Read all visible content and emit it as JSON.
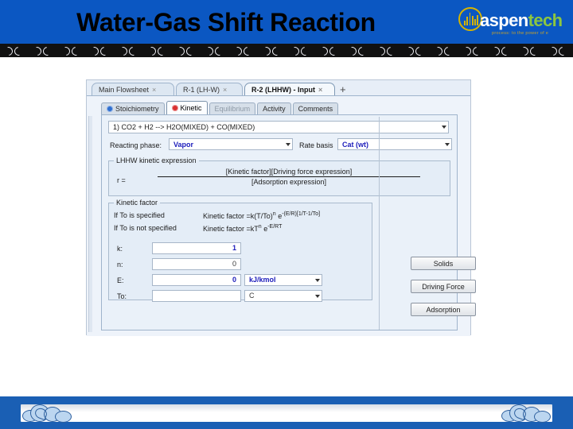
{
  "slide": {
    "title": "Water-Gas Shift Reaction",
    "logo": {
      "brand_a": "aspen",
      "brand_b": "tech",
      "tagline": "process: to the power of e",
      "mark_color": "#d6b400",
      "text_color": "#8dc63f"
    },
    "header_color": "#0b57c2",
    "footer_color": "#1a5fb4"
  },
  "window": {
    "tabs": [
      {
        "label": "Main Flowsheet",
        "close": "×",
        "active": false
      },
      {
        "label": "R-1 (LH-W)",
        "close": "×",
        "active": false
      },
      {
        "label": "R-2 (LHHW) - Input",
        "close": "×",
        "active": true
      }
    ],
    "new_tab": "+",
    "sub_tabs": [
      {
        "label": "Stoichiometry",
        "icon": "blue-circle-check-icon",
        "selected": false
      },
      {
        "label": "Kinetic",
        "icon": "red-half-circle-icon",
        "selected": true
      },
      {
        "label": "Equilibrium",
        "icon": "",
        "selected": false,
        "disabled": true
      },
      {
        "label": "Activity",
        "icon": "",
        "selected": false
      },
      {
        "label": "Comments",
        "icon": "",
        "selected": false
      }
    ],
    "reaction_select": {
      "value": "1) CO2 + H2  -->  H2O(MIXED) + CO(MIXED)"
    },
    "reacting_phase": {
      "label": "Reacting phase:",
      "value": "Vapor"
    },
    "rate_basis": {
      "label": "Rate basis",
      "value": "Cat (wt)"
    },
    "kinetic_expression": {
      "legend": "LHHW kinetic expression",
      "r_equals": "r =",
      "numerator": "[Kinetic factor][Driving force expression]",
      "denominator": "[Adsorption expression]"
    },
    "kinetic_factor": {
      "legend": "Kinetic factor",
      "line1_label": "If To is specified",
      "line1_formula_a": "Kinetic factor =k(T/To)",
      "line1_sup_n": "n",
      "line1_e": "e",
      "line1_sup_exp": "-(E/R)[1/T-1/To]",
      "line2_label": "If To is not specified",
      "line2_formula_a": "Kinetic factor =kT",
      "line2_sup_n": "n",
      "line2_e": "e",
      "line2_sup_exp": "-E/RT",
      "fields": [
        {
          "label": "k:",
          "value": "1",
          "unit": "",
          "bold": true
        },
        {
          "label": "n:",
          "value": "0",
          "unit": "",
          "bold": false
        },
        {
          "label": "E:",
          "value": "0",
          "unit": "kJ/kmol",
          "bold": true
        },
        {
          "label": "To:",
          "value": "",
          "unit": "C",
          "bold": false
        }
      ]
    },
    "buttons": [
      {
        "label": "Solids"
      },
      {
        "label": "Driving Force"
      },
      {
        "label": "Adsorption"
      }
    ]
  }
}
